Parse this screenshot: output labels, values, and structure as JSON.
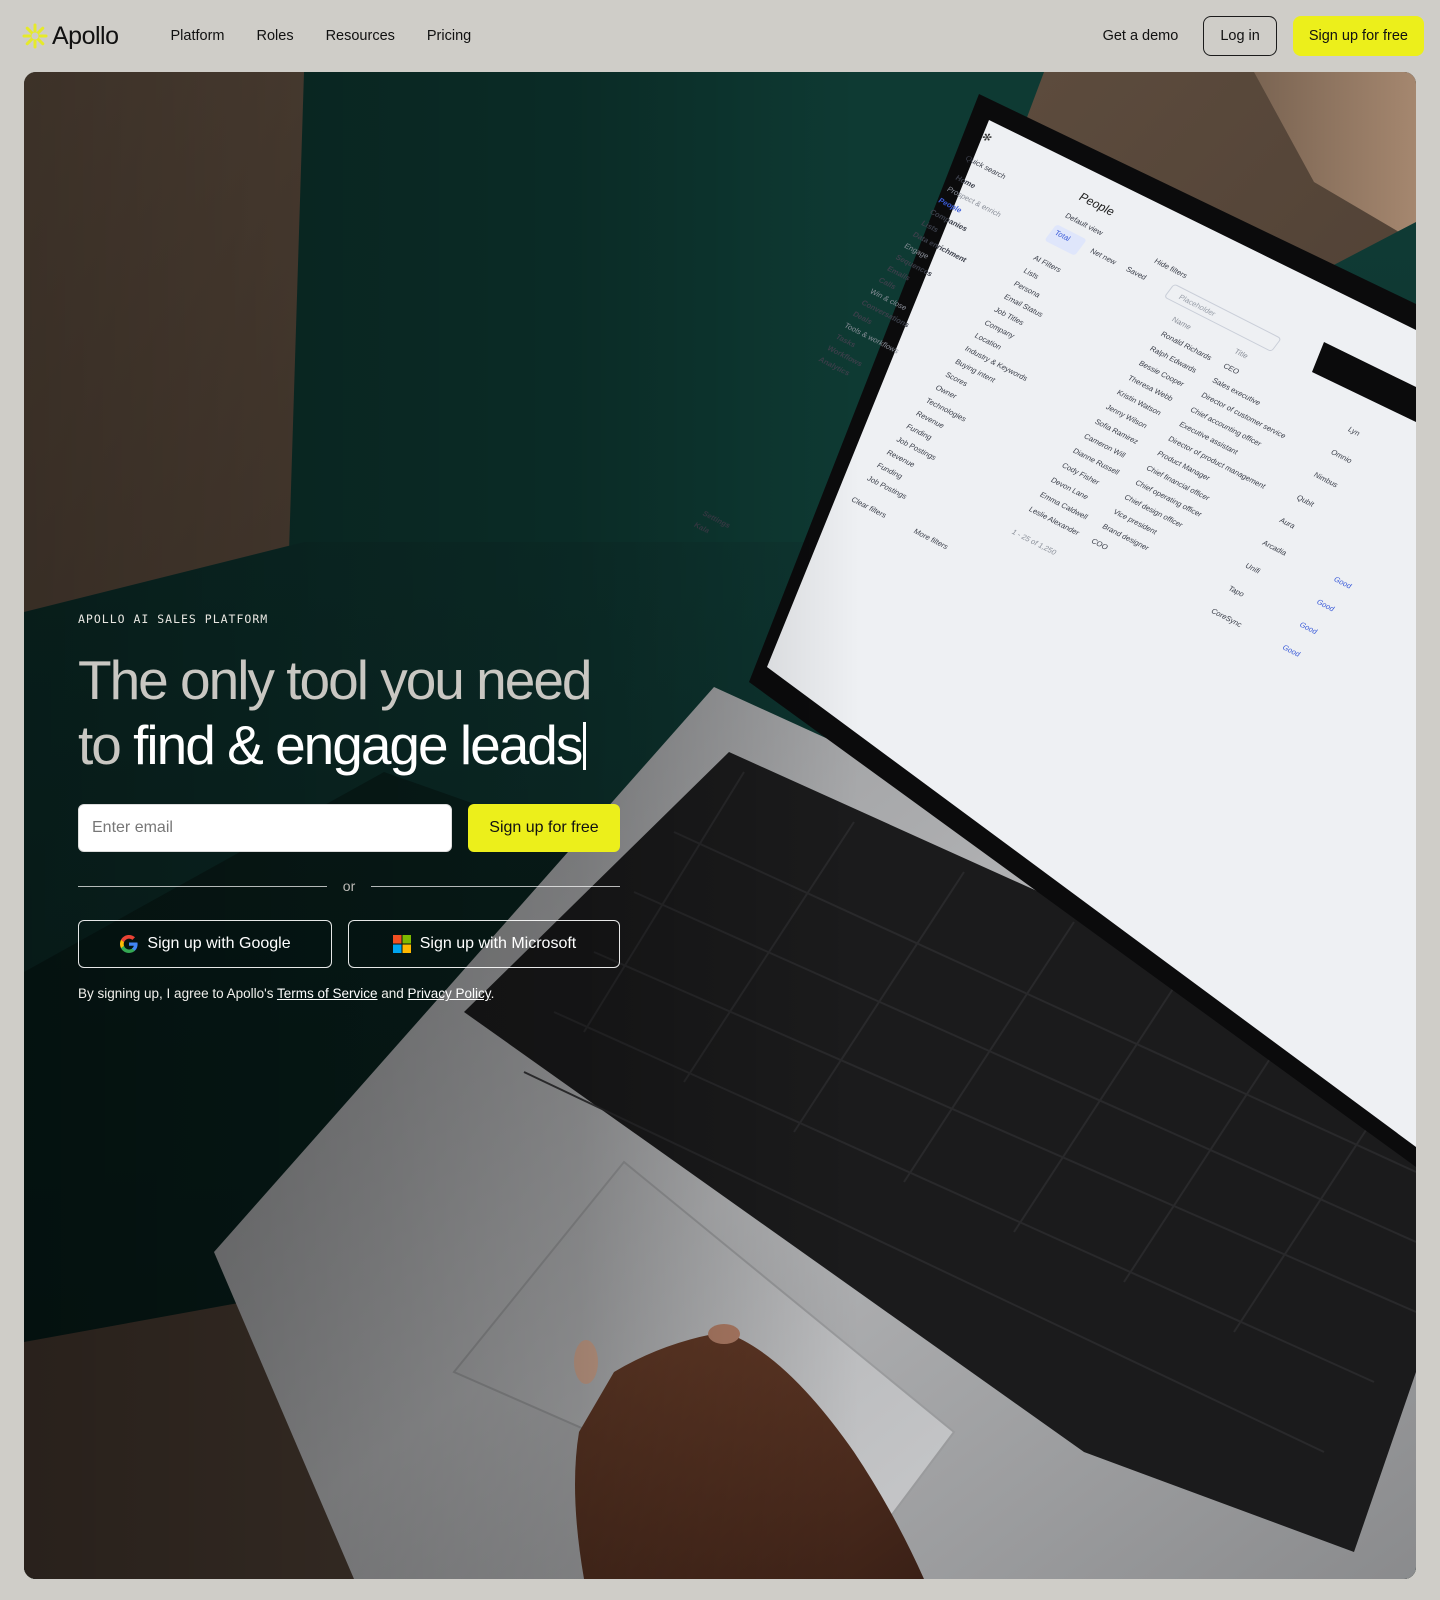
{
  "brand": {
    "name": "Apollo",
    "logo_icon": "sunburst-logo-icon",
    "accent": "#ecef1b"
  },
  "nav": {
    "items": [
      {
        "label": "Platform"
      },
      {
        "label": "Roles"
      },
      {
        "label": "Resources"
      },
      {
        "label": "Pricing"
      }
    ],
    "demo_label": "Get a demo",
    "login_label": "Log in",
    "signup_label": "Sign up for free"
  },
  "hero": {
    "eyebrow": "APOLLO AI SALES PLATFORM",
    "headline_line1": "The only tool you need",
    "headline_to": "to ",
    "headline_emph": "find & engage leads",
    "email_placeholder": "Enter email",
    "email_value": "",
    "signup_label": "Sign up for free",
    "divider_label": "or",
    "google_label": "Sign up with Google",
    "google_icon": "google-icon",
    "microsoft_label": "Sign up with Microsoft",
    "microsoft_icon": "microsoft-icon",
    "legal_prefix": "By signing up, I agree to Apollo's ",
    "terms_label": "Terms of Service",
    "legal_and": " and ",
    "privacy_label": "Privacy Policy",
    "legal_suffix": "."
  },
  "app_preview": {
    "search_label": "Quick search",
    "page_title": "People",
    "view_label": "Default view",
    "hide_filters_label": "Hide filters",
    "placeholder_label": "Placeholder",
    "tabs": [
      "Total",
      "Net new",
      "Saved"
    ],
    "sidebar": [
      "Home",
      "Prospect & enrich",
      "People",
      "Companies",
      "Lists",
      "Data enrichment",
      "Engage",
      "Sequences",
      "Emails",
      "Calls",
      "Win & close",
      "Conversations",
      "Deals",
      "Tools & workflows",
      "Tasks",
      "Workflows",
      "Analytics",
      "Settings",
      "Kala"
    ],
    "filters": [
      "AI Filters",
      "Lists",
      "Persona",
      "Email Status",
      "Job Titles",
      "Company",
      "Location",
      "Industry & Keywords",
      "Buying intent",
      "Scores",
      "Owner",
      "Technologies",
      "Revenue",
      "Funding",
      "Job Postings",
      "Revenue",
      "Funding",
      "Job Postings"
    ],
    "clear_filters_label": "Clear filters",
    "more_filters_label": "More filters",
    "pagination_label": "1 - 25 of 1,250",
    "col_name": "Name",
    "col_title": "Title",
    "rows": [
      {
        "name": "Ronald Richards",
        "title": "CEO"
      },
      {
        "name": "Ralph Edwards",
        "title": "Sales executive"
      },
      {
        "name": "Bessie Cooper",
        "title": "Director of customer service"
      },
      {
        "name": "Theresa Webb",
        "title": "Chief accounting officer"
      },
      {
        "name": "Kristin Watson",
        "title": "Executive assistant"
      },
      {
        "name": "Jenny Wilson",
        "title": "Director of product management"
      },
      {
        "name": "Sofia Ramirez",
        "title": "Product Manager"
      },
      {
        "name": "Cameron Will",
        "title": "Chief financial officer"
      },
      {
        "name": "Dianne Russell",
        "title": "Chief operating officer"
      },
      {
        "name": "Cody Fisher",
        "title": "Chief design officer"
      },
      {
        "name": "Devon Lane",
        "title": "Vice president"
      },
      {
        "name": "Emma Caldwell",
        "title": "Brand designer"
      },
      {
        "name": "Leslie Alexander",
        "title": "COO"
      }
    ],
    "companies": [
      "Lyn",
      "Omnio",
      "Nimbus",
      "Qubit",
      "Aura",
      "Arcadia",
      "Unifi",
      "Tapo",
      "CoreSync"
    ],
    "badge_label": "Good"
  }
}
